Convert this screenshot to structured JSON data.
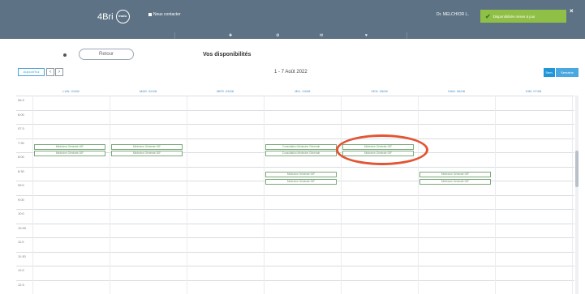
{
  "header": {
    "logo_text": "4Bri",
    "logo_badge": "tradu",
    "link_label": "Nous contacter",
    "doctor": "Dr. MELCHIOR L.",
    "toast_text": "Disponibilités mises à jour",
    "toast_close": "×"
  },
  "nav": {
    "icons": [
      "✚",
      "⚙",
      "✉",
      "♥"
    ]
  },
  "subbar": {
    "back_label": "Retour",
    "title": "Vos disponibilités"
  },
  "controls": {
    "today_label": "Aujourd'hui",
    "prev": "‹",
    "next": "›",
    "date_range": "1 - 7 Août 2022",
    "week_label": "Sem.",
    "month_label": "Semaine"
  },
  "days": [
    "LUN. 01/08",
    "MAR. 02/08",
    "MER. 03/08",
    "JEU. 04/08",
    "VEN. 05/08",
    "SAM. 06/08",
    "DIM. 07/08"
  ],
  "times": [
    "06:3",
    "6:00",
    "07:3",
    "7:30",
    "8:00",
    "8:30",
    "09:0",
    "9:00",
    "10:0",
    "10:30",
    "11:0",
    "11:30",
    "12:0",
    "12:3"
  ],
  "slots": [
    {
      "day": 0,
      "row": 0,
      "label": "Médecine Générale 00F"
    },
    {
      "day": 0,
      "row": 1,
      "label": "Médecine Générale 00F"
    },
    {
      "day": 1,
      "row": 0,
      "label": "Médecine Générale 00F"
    },
    {
      "day": 1,
      "row": 1,
      "label": "Médecine Générale 00F"
    },
    {
      "day": 3,
      "row": 0,
      "label": "Consultation Médecine Générale"
    },
    {
      "day": 3,
      "row": 1,
      "label": "Consultation Médecine Générale"
    },
    {
      "day": 4,
      "row": 0,
      "label": "Médecine Générale 00F"
    },
    {
      "day": 4,
      "row": 1,
      "label": "Médecine Générale 00F"
    },
    {
      "day": 3,
      "row": 2,
      "label": "Médecine Générale 00F"
    },
    {
      "day": 3,
      "row": 3,
      "label": "Médecine Générale 00F"
    },
    {
      "day": 5,
      "row": 2,
      "label": "Médecine Générale 00F"
    },
    {
      "day": 5,
      "row": 3,
      "label": "Médecine Générale 00F"
    }
  ]
}
